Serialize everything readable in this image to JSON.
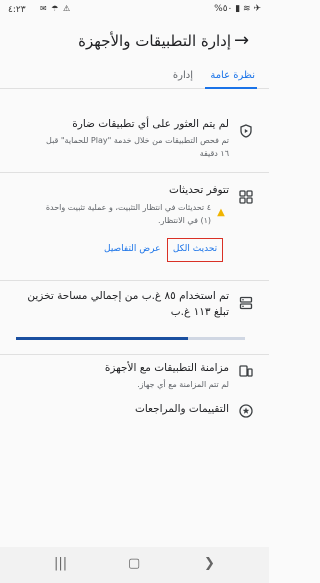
{
  "status_bar": {
    "time": "٤:٢٣",
    "left_icons": "✉ ☂ ⚠",
    "right_icons": "%٥٠ ▮ ≋ ✈"
  },
  "app_bar": {
    "title": "إدارة التطبيقات والأجهزة"
  },
  "tabs": [
    {
      "label": "نظرة عامة",
      "active": true
    },
    {
      "label": "إدارة",
      "active": false
    }
  ],
  "security": {
    "title": "لم يتم العثور على أي تطبيقات ضارة",
    "subtitle_line1": "تم فحص التطبيقات من خلال خدمة \"Play للحماية\" قبل",
    "subtitle_line2": "١٦ دقيقة"
  },
  "updates": {
    "title": "تتوفر تحديثات",
    "subtitle_line1": "٤ تحديثات في انتظار التثبيت، و عملية تثبيت واحدة",
    "subtitle_line2": "(١) في الانتظار.",
    "update_all": "تحديث الكل",
    "details": "عرض التفاصيل"
  },
  "storage": {
    "line1": "تم استخدام ٨٥ غ.ب من إجمالي مساحة تخزين",
    "line2": "تبلغ ١١٣ غ.ب",
    "used_fraction": 0.75,
    "fill_color": "#1a4fa0"
  },
  "devices": {
    "title": "مزامنة التطبيقات مع الأجهزة",
    "subtitle": "لم تتم المزامنة مع أي جهاز."
  },
  "ratings": {
    "title": "التقييمات والمراجعات"
  },
  "accent_color": "#1a73e8",
  "highlight_color": "#d93025"
}
